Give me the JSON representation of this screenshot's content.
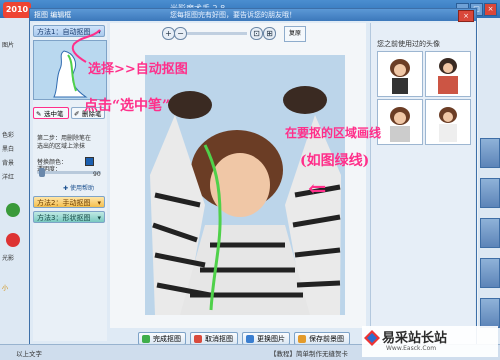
{
  "window": {
    "title": "光影魔术手 2.8"
  },
  "dialog": {
    "title": "抠图 编辑框",
    "banner": "您每抠图完有好图，要告诉您的朋友哦！",
    "close": "×"
  },
  "left_panel": {
    "method1": "方法1：自动抠图",
    "tool1": "选中笔",
    "tool2": "删除笔",
    "step2_text_a": "第二步：用删除笔在",
    "step2_text_b": "选出的区域上涂抹",
    "color_label": "替换颜色：",
    "opacity_label": "透明度：",
    "opacity_value": "90",
    "help": "使用帮助",
    "method2": "方法2：手动抠图",
    "method3": "方法3：形状抠图"
  },
  "toolbar": {
    "zoom_in": "+",
    "zoom_out": "−",
    "reset": "复原"
  },
  "bottom_buttons": [
    {
      "label": "完成抠图",
      "color": "#3fae4a"
    },
    {
      "label": "取消抠图",
      "color": "#d94a3c"
    },
    {
      "label": "更换图片",
      "color": "#3a7ed0"
    },
    {
      "label": "保存前景图",
      "color": "#e39b2c"
    }
  ],
  "right_panel": {
    "title": "您之前使用过的头像"
  },
  "annotations": {
    "a1": "选择>>自动抠图",
    "a2": "点击“选中笔”",
    "a3": "在要抠的区域画线",
    "a4": "(如图绿线)",
    "arrow": "⇐"
  },
  "sidebar": {
    "items": [
      "图片",
      "色彩",
      "黑白",
      "背景",
      "洋红",
      "光影",
      "小"
    ]
  },
  "status": {
    "left": "以上文字",
    "right": "【教程】简单制作无缝贺卡"
  },
  "watermark": {
    "title": "易采站长站",
    "url": "Www.Easck.Com"
  },
  "colors": {
    "accent": "#ff2f8a",
    "draw_line": "#4fd14a",
    "title_blue": "#3c78bb"
  }
}
